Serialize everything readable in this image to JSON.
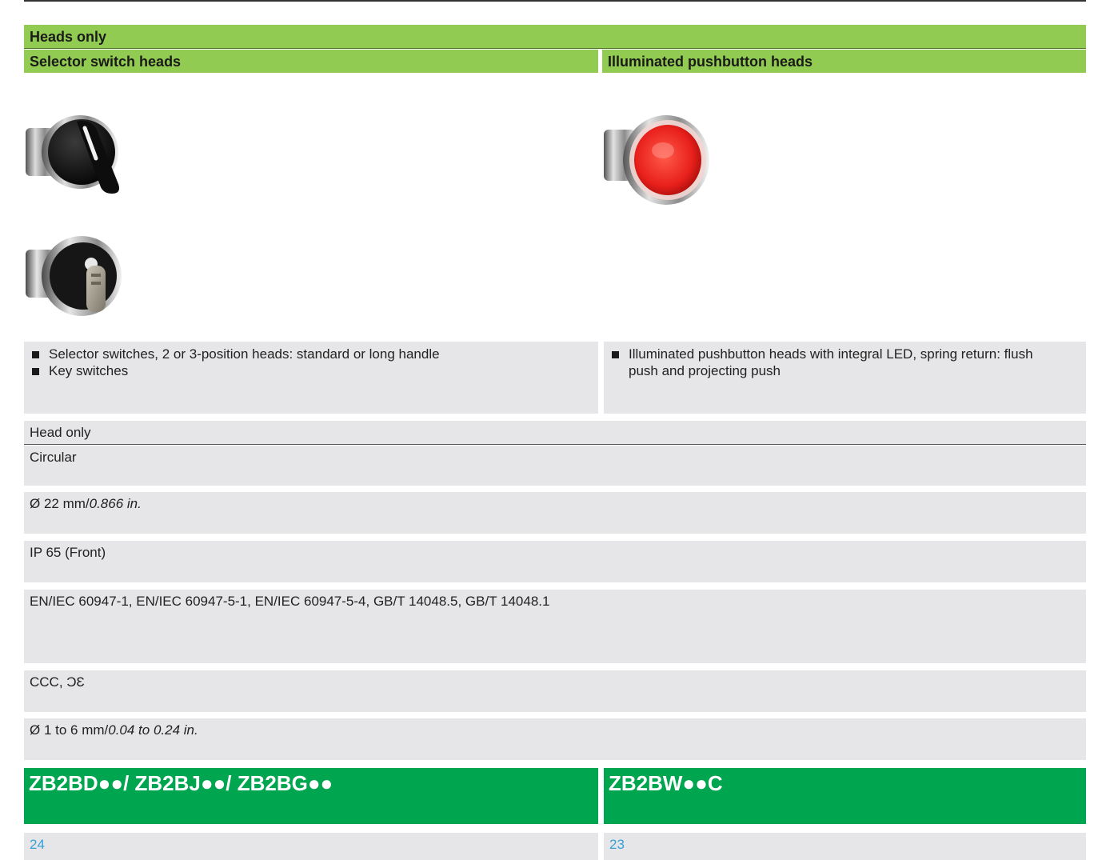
{
  "section": {
    "heads_only": "Heads only",
    "selector_title": "Selector switch heads",
    "illuminated_title": "Illuminated pushbutton heads"
  },
  "selector_features": [
    "Selector switches, 2 or 3-position heads: standard or long handle",
    "Key switches"
  ],
  "illuminated_features": [
    "Illuminated pushbutton heads with integral LED, spring return: flush push and projecting push"
  ],
  "specs": {
    "head_only": "Head only",
    "shape": "Circular",
    "diameter_main": "Ø 22 mm/",
    "diameter_alt": "0.866 in.",
    "protection": "IP 65 (Front)",
    "standards": "EN/IEC 60947-1, EN/IEC 60947-5-1, EN/IEC 60947-5-4, GB/T 14048.5, GB/T 14048.1",
    "approvals": "CCC, ƆƐ",
    "cable_main": "Ø 1 to 6 mm/",
    "cable_alt": "0.04 to 0.24 in."
  },
  "references": {
    "selector": "ZB2BD●●/ ZB2BJ●●/ ZB2BG●●",
    "illuminated": "ZB2BW●●C"
  },
  "pages": {
    "selector": "24",
    "illuminated": "23"
  },
  "colors": {
    "light_green": "#92cb52",
    "dark_green": "#00a54f",
    "grey_band": "#e6e6e8",
    "link_blue": "#3aa0d8",
    "red_button": "#e8201c"
  },
  "images": {
    "selector_head": "selector-switch-head-photo",
    "key_switch": "key-switch-head-photo",
    "illuminated_head": "red-illuminated-pushbutton-photo"
  }
}
